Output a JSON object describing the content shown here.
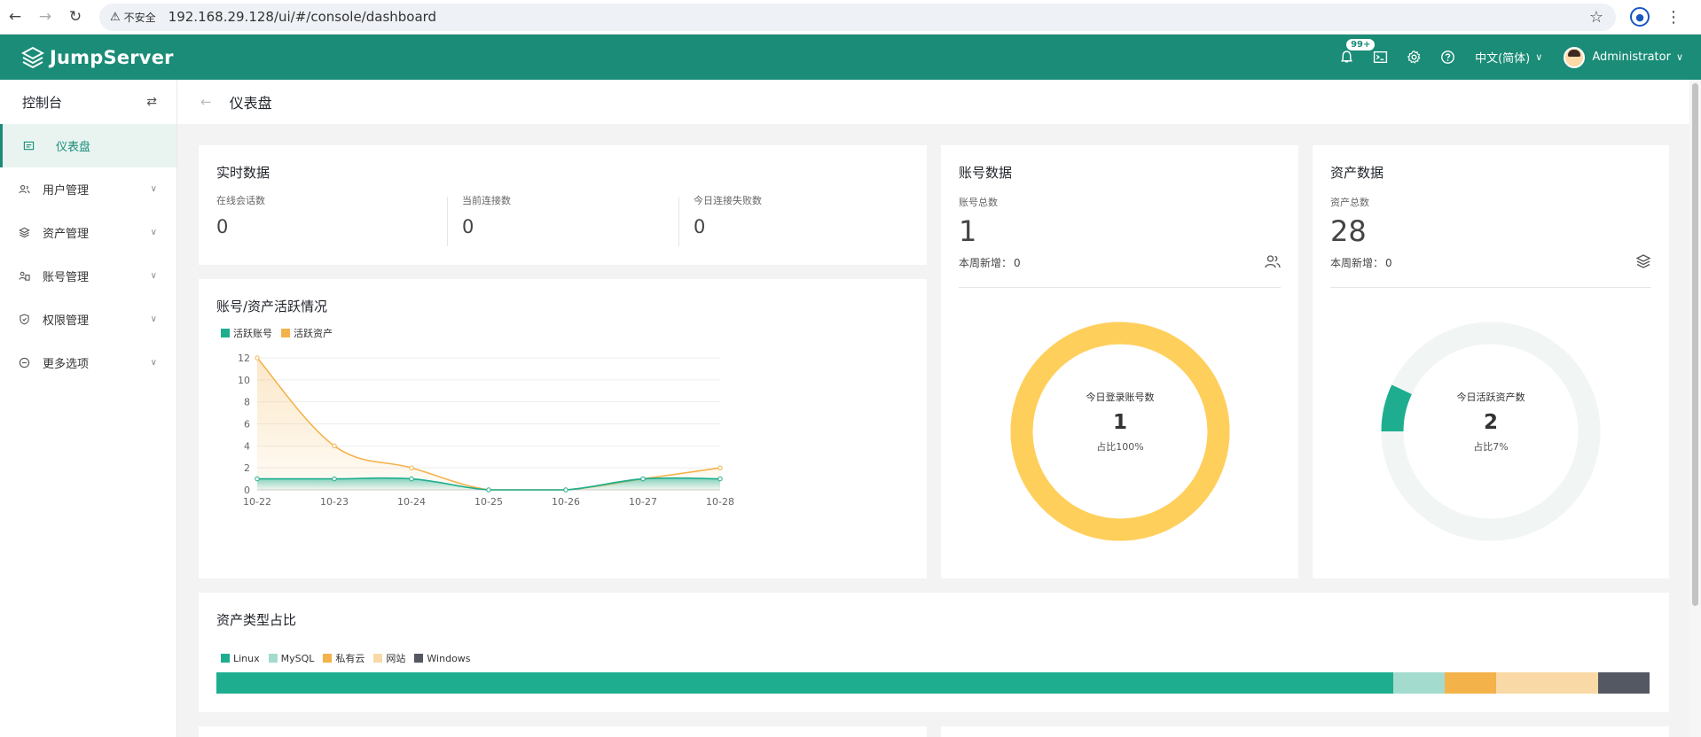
{
  "browser": {
    "insecure_label": "不安全",
    "url": "192.168.29.128/ui/#/console/dashboard"
  },
  "header": {
    "brand": "JumpServer",
    "notification_badge": "99+",
    "language": "中文(简体)",
    "username": "Administrator",
    "accent_color": "#1a8c77"
  },
  "sidebar": {
    "title": "控制台",
    "items": [
      {
        "label": "仪表盘",
        "icon": "dashboard-icon",
        "active": true
      },
      {
        "label": "用户管理",
        "icon": "users-icon"
      },
      {
        "label": "资产管理",
        "icon": "stack-icon"
      },
      {
        "label": "账号管理",
        "icon": "accounts-icon"
      },
      {
        "label": "权限管理",
        "icon": "shield-icon"
      },
      {
        "label": "更多选项",
        "icon": "more-icon"
      }
    ]
  },
  "page": {
    "title": "仪表盘"
  },
  "realtime": {
    "title": "实时数据",
    "metrics": [
      {
        "label": "在线会话数",
        "value": "0"
      },
      {
        "label": "当前连接数",
        "value": "0"
      },
      {
        "label": "今日连接失败数",
        "value": "0"
      }
    ]
  },
  "account_stats": {
    "title": "账号数据",
    "total_label": "账号总数",
    "total": "1",
    "week_label": "本周新增：",
    "week_value": "0",
    "donut": {
      "label": "今日登录账号数",
      "value": "1",
      "ratio_text": "占比100%",
      "fraction": 1.0,
      "color": "#ffcf5c"
    }
  },
  "asset_stats": {
    "title": "资产数据",
    "total_label": "资产总数",
    "total": "28",
    "week_label": "本周新增：",
    "week_value": "0",
    "donut": {
      "label": "今日活跃资产数",
      "value": "2",
      "ratio_text": "占比7%",
      "fraction": 0.07,
      "color": "#1eae8f",
      "track_color": "#f1f5f4"
    }
  },
  "activity": {
    "title": "账号/资产活跃情况"
  },
  "chart_data": {
    "type": "area",
    "x": [
      "10-22",
      "10-23",
      "10-24",
      "10-25",
      "10-26",
      "10-27",
      "10-28"
    ],
    "series": [
      {
        "name": "活跃账号",
        "values": [
          1,
          1,
          1,
          0,
          0,
          1,
          1
        ],
        "color": "#1eae8f"
      },
      {
        "name": "活跃资产",
        "values": [
          12,
          4,
          2,
          0,
          0,
          1,
          2
        ],
        "color": "#f4b24a"
      }
    ],
    "yticks": [
      0,
      2,
      4,
      6,
      8,
      10,
      12
    ],
    "ylim": [
      0,
      12
    ],
    "grid": true,
    "legend_position": "top-left"
  },
  "asset_types": {
    "title": "资产类型占比",
    "types": [
      {
        "name": "Linux",
        "share": 0.82,
        "color": "#1eae8f"
      },
      {
        "name": "MySQL",
        "share": 0.036,
        "color": "#a3dccf"
      },
      {
        "name": "私有云",
        "share": 0.036,
        "color": "#f4b24a"
      },
      {
        "name": "网站",
        "share": 0.071,
        "color": "#f9d9a5"
      },
      {
        "name": "Windows",
        "share": 0.036,
        "color": "#535862"
      }
    ]
  }
}
